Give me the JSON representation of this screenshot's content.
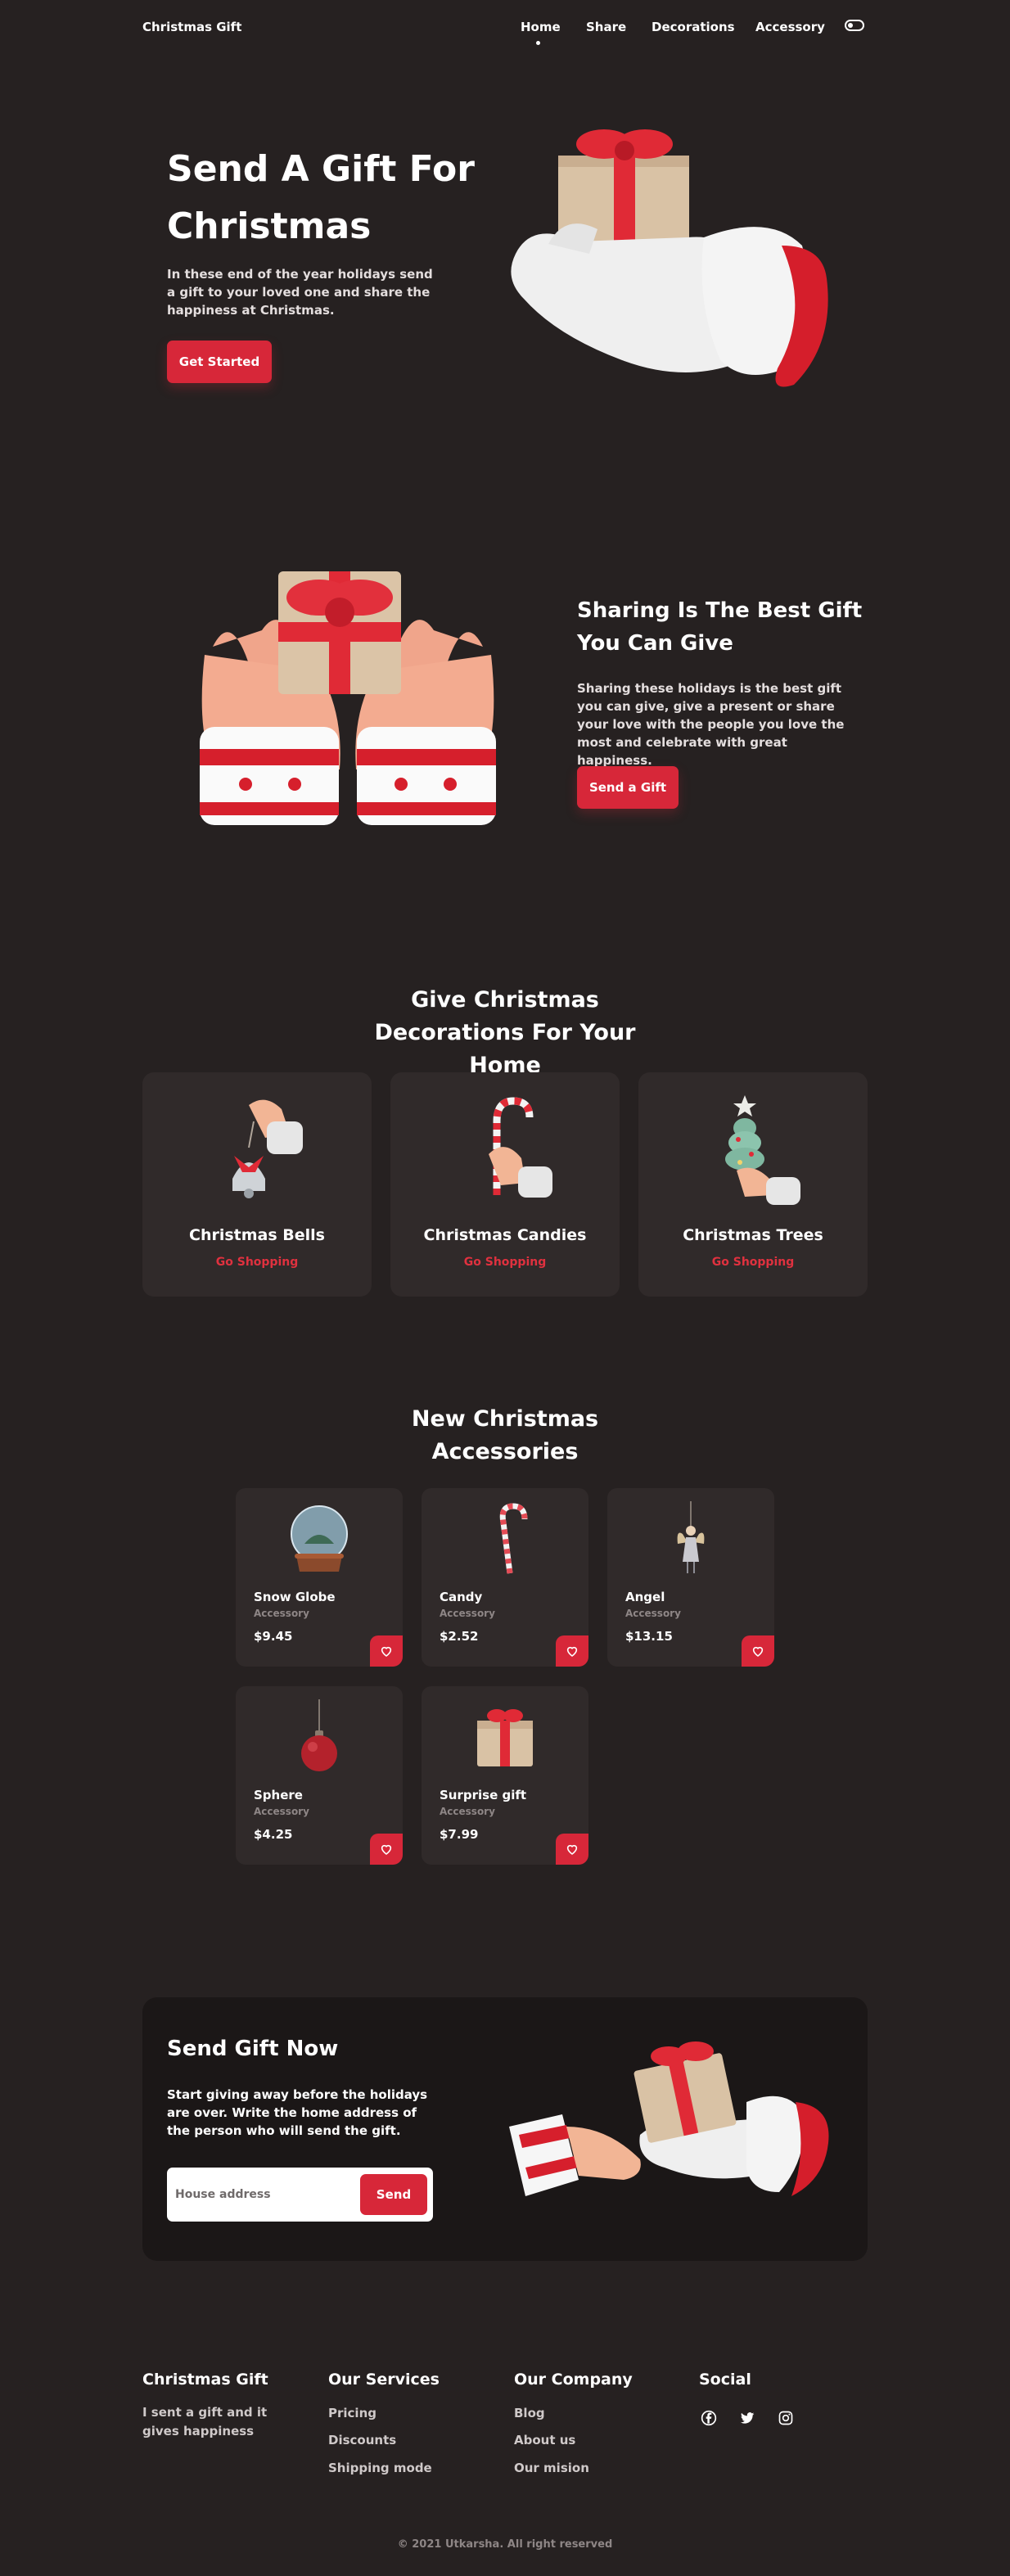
{
  "header": {
    "brand": "Christmas Gift",
    "nav": [
      "Home",
      "Share",
      "Decorations",
      "Accessory"
    ],
    "active_nav": "Home",
    "theme_toggle_icon": "toggle-icon"
  },
  "hero": {
    "title": "Send A Gift For Christmas",
    "description": "In these end of the year holidays send a gift to your loved one and share the happiness at Christmas.",
    "button": "Get Started",
    "image_icon": "gloved-hand-holding-gift-icon"
  },
  "share": {
    "title": "Sharing Is The Best Gift You Can Give",
    "description": "Sharing these holidays is the best gift you can give, give a present or share your love with the people you love the most and celebrate with great happiness.",
    "button": "Send a Gift",
    "image_icon": "hands-holding-gift-icon"
  },
  "decorations": {
    "title": "Give Christmas Decorations For Your Home",
    "cards": [
      {
        "name": "Christmas Bells",
        "link": "Go Shopping",
        "icon": "hand-holding-bell-icon"
      },
      {
        "name": "Christmas Candies",
        "link": "Go Shopping",
        "icon": "hand-holding-candy-cane-icon"
      },
      {
        "name": "Christmas Trees",
        "link": "Go Shopping",
        "icon": "hand-holding-tree-icon"
      }
    ]
  },
  "accessories": {
    "title": "New Christmas Accessories",
    "items": [
      {
        "name": "Snow Globe",
        "category": "Accessory",
        "price": "$9.45",
        "icon": "snow-globe-icon"
      },
      {
        "name": "Candy",
        "category": "Accessory",
        "price": "$2.52",
        "icon": "candy-cane-icon"
      },
      {
        "name": "Angel",
        "category": "Accessory",
        "price": "$13.15",
        "icon": "angel-ornament-icon"
      },
      {
        "name": "Sphere",
        "category": "Accessory",
        "price": "$4.25",
        "icon": "sphere-ornament-icon"
      },
      {
        "name": "Surprise gift",
        "category": "Accessory",
        "price": "$7.99",
        "icon": "gift-box-icon"
      }
    ],
    "favorite_icon": "heart-icon"
  },
  "send": {
    "title": "Send Gift Now",
    "description": "Start giving away before the holidays are over. Write the home address of the person who will send the gift.",
    "input_placeholder": "House address",
    "input_value": "",
    "button": "Send",
    "image_icon": "hands-exchanging-gift-icon"
  },
  "footer": {
    "brand": "Christmas Gift",
    "tagline": "I sent a gift and it gives happiness",
    "services_title": "Our Services",
    "services": [
      "Pricing",
      "Discounts",
      "Shipping mode"
    ],
    "company_title": "Our Company",
    "company": [
      "Blog",
      "About us",
      "Our mision"
    ],
    "social_title": "Social",
    "social_icons": [
      "facebook-icon",
      "twitter-icon",
      "instagram-icon"
    ],
    "copyright": "© 2021 Utkarsha. All right reserved"
  },
  "colors": {
    "background": "#262121",
    "card": "#302a2a",
    "panel": "#1b1717",
    "accent": "#d72739",
    "text": "#ffffff",
    "muted": "#8e8686"
  }
}
